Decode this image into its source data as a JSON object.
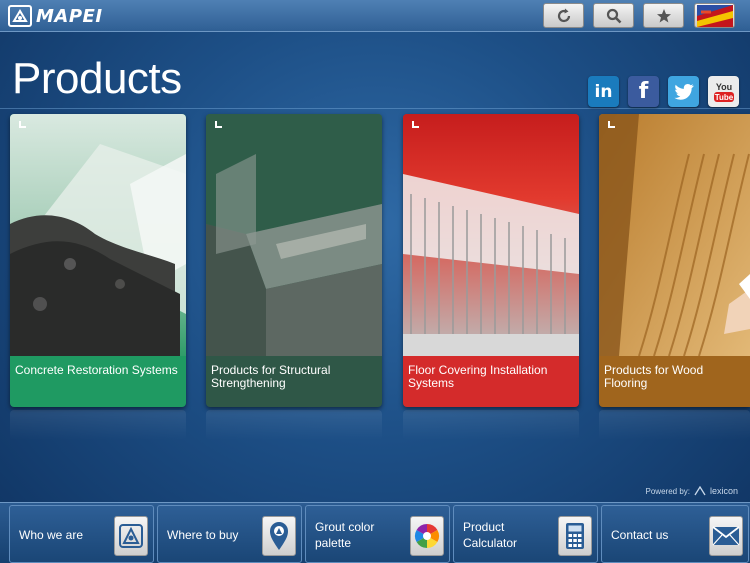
{
  "header": {
    "brand": "MAPEI",
    "buttons": [
      {
        "name": "refresh-icon"
      },
      {
        "name": "search-icon"
      },
      {
        "name": "star-icon"
      },
      {
        "name": "language-flag-icon"
      }
    ]
  },
  "page": {
    "title": "Products"
  },
  "social": [
    {
      "name": "linkedin-icon",
      "glyph": "in",
      "color": "#1a7bbd"
    },
    {
      "name": "facebook-icon",
      "glyph": "f",
      "color": "#3b5b9e"
    },
    {
      "name": "twitter-icon",
      "glyph": "",
      "color": "#3fa5e0"
    },
    {
      "name": "youtube-icon",
      "glyph": "You Tube",
      "color": "#e9e9e9"
    }
  ],
  "products": [
    {
      "label": "Concrete Restoration Systems",
      "color": "#1f9a62"
    },
    {
      "label": "Products for Structural Strengthening",
      "color": "#2f5747"
    },
    {
      "label": "Floor Covering Installation Systems",
      "color": "#d42b2b"
    },
    {
      "label": "Products for Wood Flooring",
      "color": "#a0651d"
    }
  ],
  "footer": {
    "powered_by": "Powered by:",
    "powered_brand": "lexicon"
  },
  "nav": [
    {
      "label": "Who we are",
      "icon": "mapei-logo-icon"
    },
    {
      "label": "Where to buy",
      "icon": "map-pin-icon"
    },
    {
      "label": "Grout color palette",
      "icon": "color-wheel-icon"
    },
    {
      "label": "Product Calculator",
      "icon": "calculator-icon"
    },
    {
      "label": "Contact us",
      "icon": "mail-icon"
    }
  ]
}
